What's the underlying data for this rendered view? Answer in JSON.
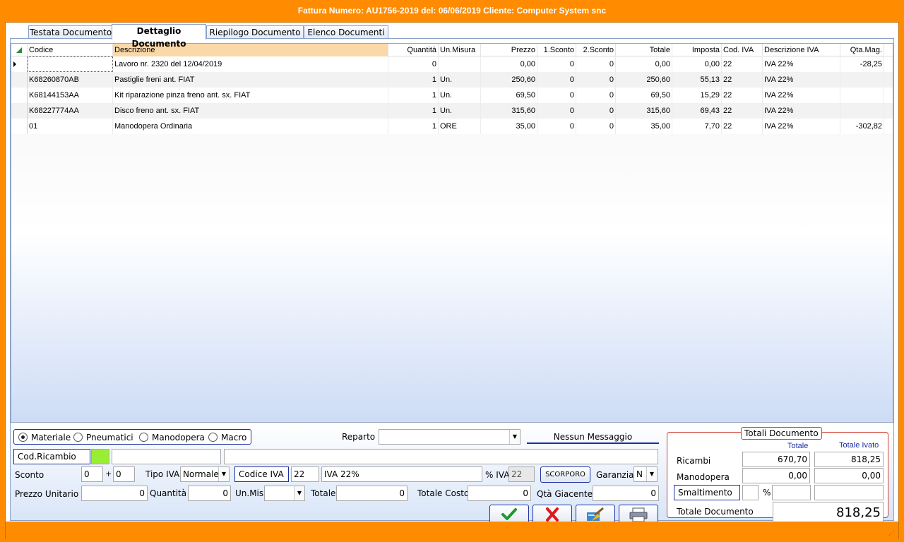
{
  "window": {
    "title": "Fattura  Numero: AU1756-2019 del: 06/06/2019 Cliente: Computer System snc"
  },
  "tabs": [
    {
      "label": "Testata Documento",
      "selected": false
    },
    {
      "label": "Dettaglio Documento",
      "selected": true
    },
    {
      "label": "Riepilogo Documento",
      "selected": false
    },
    {
      "label": "Elenco Documenti",
      "selected": false
    }
  ],
  "grid": {
    "columns": [
      "Codice",
      "Descrizione",
      "Quantità",
      "Un.Misura",
      "Prezzo",
      "1.Sconto",
      "2.Sconto",
      "Totale",
      "Imposta",
      "Cod. IVA",
      "Descrizione IVA",
      "Qta.Mag."
    ],
    "rows": [
      [
        "",
        "Lavoro nr. 2320   del 12/04/2019",
        "0",
        "",
        "0,00",
        "0",
        "0",
        "0,00",
        "0,00",
        "22",
        "IVA 22%",
        "-28,25"
      ],
      [
        "K68260870AB",
        "Pastiglie freni  ant. FIAT",
        "1",
        "Un.",
        "250,60",
        "0",
        "0",
        "250,60",
        "55,13",
        "22",
        "IVA 22%",
        ""
      ],
      [
        "K68144153AA",
        "Kit riparazione pinza freno  ant. sx. FIAT",
        "1",
        "Un.",
        "69,50",
        "0",
        "0",
        "69,50",
        "15,29",
        "22",
        "IVA 22%",
        ""
      ],
      [
        "K68227774AA",
        "Disco freno  ant. sx. FIAT",
        "1",
        "Un.",
        "315,60",
        "0",
        "0",
        "315,60",
        "69,43",
        "22",
        "IVA 22%",
        ""
      ],
      [
        "01",
        "Manodopera Ordinaria",
        "1",
        "ORE",
        "35,00",
        "0",
        "0",
        "35,00",
        "7,70",
        "22",
        "IVA 22%",
        "-302,82"
      ]
    ]
  },
  "type_radio": {
    "options": [
      "Materiale",
      "Pneumatici",
      "Manodopera",
      "Macro"
    ],
    "selected": "Materiale"
  },
  "form": {
    "reparto_label": "Reparto",
    "reparto_value": "",
    "message": "Nessun Messaggio",
    "cod_ricambio_label": "Cod.Ricambio",
    "cod_ricambio_value": "",
    "descrizione_value": "",
    "descrizione_extra": "",
    "sconto_label": "Sconto",
    "sconto1": "0",
    "plus": "+",
    "sconto2": "0",
    "tipo_iva_label": "Tipo IVA",
    "tipo_iva_value": "Normale",
    "codice_iva_label": "Codice IVA",
    "codice_iva_value": "22",
    "descr_iva_value": "IVA 22%",
    "perc_iva_label": "% IVA",
    "perc_iva_value": "22",
    "scorporo_label": "SCORPORO",
    "garanzia_label": "Garanzia",
    "garanzia_value": "N",
    "prezzo_unitario_label": "Prezzo Unitario",
    "prezzo_unitario_value": "0",
    "quantita_label": "Quantità",
    "quantita_value": "0",
    "unmis_label": "Un.Mis",
    "unmis_value": "",
    "totale_label": "Totale",
    "totale_value": "0",
    "totale_costo_label": "Totale Costo",
    "totale_costo_value": "0",
    "qta_giacente_label": "Qtà Giacente",
    "qta_giacente_value": "0"
  },
  "totals": {
    "title": "Totali Documento",
    "col_totale": "Totale",
    "col_ivato": "Totale Ivato",
    "ricambi_label": "Ricambi",
    "ricambi_totale": "670,70",
    "ricambi_ivato": "818,25",
    "manodopera_label": "Manodopera",
    "manodopera_totale": "0,00",
    "manodopera_ivato": "0,00",
    "smaltimento_label": "Smaltimento",
    "smaltimento_value": "",
    "perc_symbol": "%",
    "smaltimento_perc": "",
    "smaltimento_total": "",
    "documento_label": "Totale Documento",
    "documento_value": "818,25"
  },
  "colors": {
    "accent": "#ff8c00",
    "frame_blue": "#1a2fa0",
    "header_highlight": "#fbd8a8",
    "cod_ricambio_swatch": "#99ee33"
  }
}
